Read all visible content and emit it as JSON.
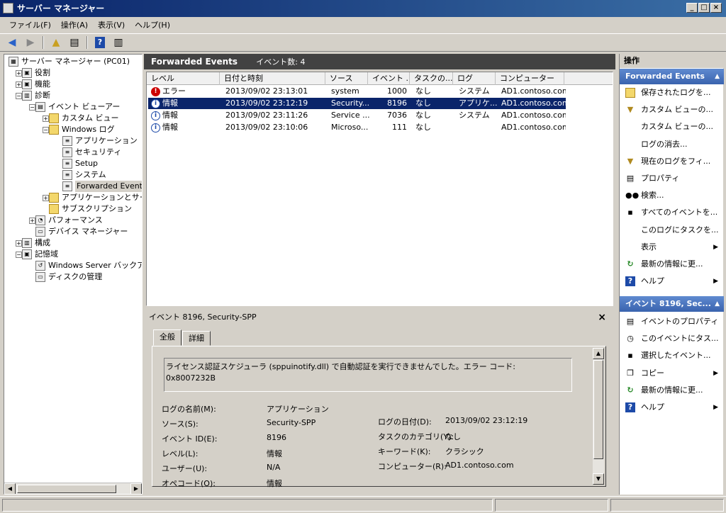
{
  "window": {
    "title": "サーバー マネージャー",
    "min": "_",
    "max": "□",
    "close": "×"
  },
  "menu": [
    "ファイル(F)",
    "操作(A)",
    "表示(V)",
    "ヘルプ(H)"
  ],
  "tree": [
    {
      "label": "サーバー マネージャー (PC01)",
      "icon": "server-manager-icon",
      "level": 0,
      "expander": ""
    },
    {
      "label": "役割",
      "icon": "roles-icon",
      "level": 1,
      "expander": "+"
    },
    {
      "label": "機能",
      "icon": "features-icon",
      "level": 1,
      "expander": "+"
    },
    {
      "label": "診断",
      "icon": "diagnostics-icon",
      "level": 1,
      "expander": "−"
    },
    {
      "label": "イベント ビューアー",
      "icon": "event-viewer-icon",
      "level": 2,
      "expander": "−"
    },
    {
      "label": "カスタム ビュー",
      "icon": "folder-icon",
      "level": 3,
      "expander": "+"
    },
    {
      "label": "Windows ログ",
      "icon": "folder-icon",
      "level": 3,
      "expander": "−"
    },
    {
      "label": "アプリケーション",
      "icon": "log-icon",
      "level": 4,
      "expander": ""
    },
    {
      "label": "セキュリティ",
      "icon": "log-icon",
      "level": 4,
      "expander": ""
    },
    {
      "label": "Setup",
      "icon": "log-icon",
      "level": 4,
      "expander": ""
    },
    {
      "label": "システム",
      "icon": "log-icon",
      "level": 4,
      "expander": ""
    },
    {
      "label": "Forwarded Events",
      "icon": "log-icon",
      "level": 4,
      "expander": "",
      "selected": true
    },
    {
      "label": "アプリケーションとサービス",
      "icon": "folder-icon",
      "level": 3,
      "expander": "+"
    },
    {
      "label": "サブスクリプション",
      "icon": "subscription-icon",
      "level": 3,
      "expander": ""
    },
    {
      "label": "パフォーマンス",
      "icon": "performance-icon",
      "level": 2,
      "expander": "+"
    },
    {
      "label": "デバイス マネージャー",
      "icon": "device-manager-icon",
      "level": 2,
      "expander": ""
    },
    {
      "label": "構成",
      "icon": "configuration-icon",
      "level": 1,
      "expander": "+"
    },
    {
      "label": "記憶域",
      "icon": "storage-icon",
      "level": 1,
      "expander": "−"
    },
    {
      "label": "Windows Server バックアップ",
      "icon": "backup-icon",
      "level": 2,
      "expander": ""
    },
    {
      "label": "ディスクの管理",
      "icon": "disk-icon",
      "level": 2,
      "expander": ""
    }
  ],
  "center": {
    "title": "Forwarded Events",
    "count_label": "イベント数: 4"
  },
  "columns": [
    "レベル",
    "日付と時刻",
    "ソース",
    "イベント ...",
    "タスクの...",
    "ログ",
    "コンピューター"
  ],
  "events": [
    {
      "level": "エラー",
      "type": "error",
      "datetime": "2013/09/02 23:13:01",
      "source": "system",
      "id": "1000",
      "task": "なし",
      "log": "システム",
      "computer": "AD1.contoso.com"
    },
    {
      "level": "情報",
      "type": "info",
      "datetime": "2013/09/02 23:12:19",
      "source": "Security...",
      "id": "8196",
      "task": "なし",
      "log": "アプリケ...",
      "computer": "AD1.contoso.com",
      "selected": true
    },
    {
      "level": "情報",
      "type": "info",
      "datetime": "2013/09/02 23:11:26",
      "source": "Service ...",
      "id": "7036",
      "task": "なし",
      "log": "システム",
      "computer": "AD1.contoso.com"
    },
    {
      "level": "情報",
      "type": "info",
      "datetime": "2013/09/02 23:10:06",
      "source": "Microso...",
      "id": "111",
      "task": "なし",
      "log": "",
      "computer": "AD1.contoso.com"
    }
  ],
  "detail": {
    "title": "イベント 8196, Security-SPP",
    "tabs": [
      "全般",
      "詳細"
    ],
    "message_line1": "ライセンス認証スケジューラ (sppuinotify.dll) で自動認証を実行できませんでした。エラー コード:",
    "message_line2": "0x8007232B",
    "fields_left": [
      {
        "label": "ログの名前(M):",
        "value": "アプリケーション"
      },
      {
        "label": "ソース(S):",
        "value": "Security-SPP"
      },
      {
        "label": "イベント ID(E):",
        "value": "8196"
      },
      {
        "label": "レベル(L):",
        "value": "情報"
      },
      {
        "label": "ユーザー(U):",
        "value": "N/A"
      },
      {
        "label": "オペコード(O):",
        "value": "情報"
      }
    ],
    "fields_right": [
      {
        "label": "ログの日付(D):",
        "value": "2013/09/02 23:12:19"
      },
      {
        "label": "タスクのカテゴリ(Y):",
        "value": "なし"
      },
      {
        "label": "キーワード(K):",
        "value": "クラシック"
      },
      {
        "label": "コンピューター(R):",
        "value": "AD1.contoso.com"
      }
    ]
  },
  "actions": {
    "title": "操作",
    "section1": "Forwarded Events",
    "items1": [
      {
        "label": "保存されたログを...",
        "icon": "open-folder-icon",
        "submenu": false
      },
      {
        "label": "カスタム ビューの...",
        "icon": "filter-icon",
        "submenu": false
      },
      {
        "label": "カスタム ビューの...",
        "icon": "",
        "submenu": false
      },
      {
        "label": "ログの消去...",
        "icon": "",
        "submenu": false
      },
      {
        "label": "現在のログをフィ...",
        "icon": "filter-icon",
        "submenu": false
      },
      {
        "label": "プロパティ",
        "icon": "properties-icon",
        "submenu": false
      },
      {
        "label": "検索...",
        "icon": "binoculars-icon",
        "submenu": false
      },
      {
        "label": "すべてのイベントを...",
        "icon": "save-icon",
        "submenu": false
      },
      {
        "label": "このログにタスクを...",
        "icon": "",
        "submenu": false
      },
      {
        "label": "表示",
        "icon": "",
        "submenu": true
      },
      {
        "label": "最新の情報に更...",
        "icon": "refresh-icon",
        "submenu": false
      },
      {
        "label": "ヘルプ",
        "icon": "help-icon",
        "submenu": true
      }
    ],
    "section2": "イベント 8196, Sec...",
    "items2": [
      {
        "label": "イベントのプロパティ",
        "icon": "properties-icon",
        "submenu": false
      },
      {
        "label": "このイベントにタス...",
        "icon": "task-icon",
        "submenu": false
      },
      {
        "label": "選択したイベント...",
        "icon": "save-icon",
        "submenu": false
      },
      {
        "label": "コピー",
        "icon": "copy-icon",
        "submenu": true
      },
      {
        "label": "最新の情報に更...",
        "icon": "refresh-icon",
        "submenu": false
      },
      {
        "label": "ヘルプ",
        "icon": "help-icon",
        "submenu": true
      }
    ]
  }
}
